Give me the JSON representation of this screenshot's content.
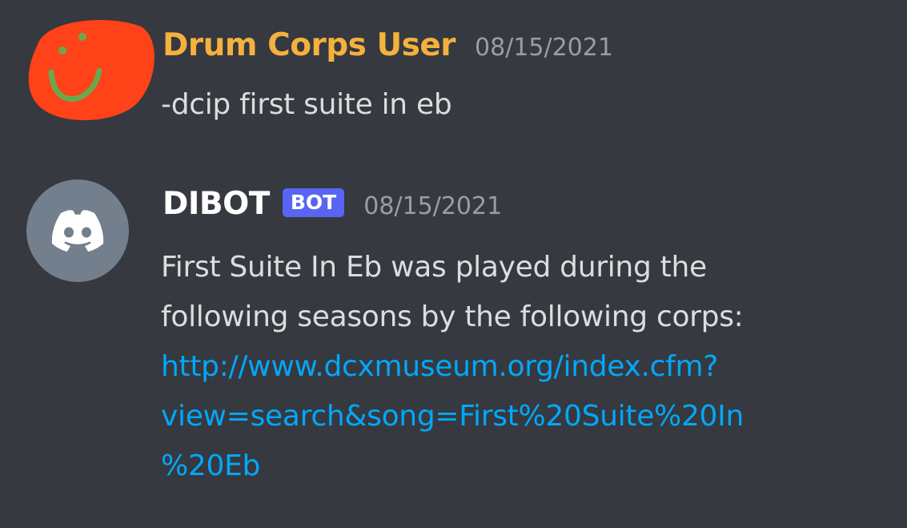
{
  "messages": [
    {
      "author": "Drum Corps User",
      "timestamp": "08/15/2021",
      "text": "-dcip first suite in eb",
      "avatar_icon": "hand-drawn-smiley-avatar",
      "name_color": "#f5b13d"
    },
    {
      "author": "DIBOT",
      "badge": "BOT",
      "timestamp": "08/15/2021",
      "text_lines": [
        "First Suite In Eb was played during the",
        "following seasons by the following corps:"
      ],
      "link_lines": [
        "http://www.dcxmuseum.org/index.cfm?",
        "view=search&song=First%20Suite%20In",
        "%20Eb"
      ],
      "avatar_icon": "discord-logo-icon",
      "name_color": "#ffffff",
      "badge_color": "#5865f2",
      "link_color": "#00a8fc"
    }
  ],
  "theme": {
    "background": "#36393f",
    "timestamp_color": "#9a9da2"
  }
}
